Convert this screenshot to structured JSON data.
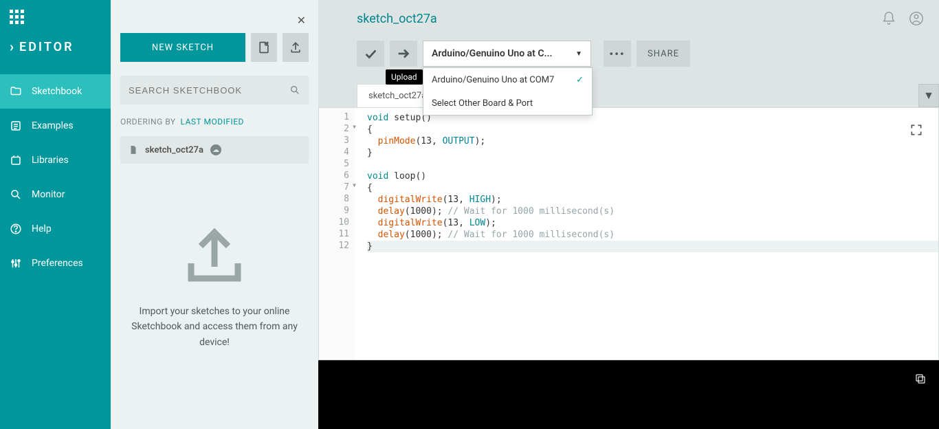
{
  "leftnav": {
    "title": "EDITOR",
    "items": [
      {
        "label": "Sketchbook"
      },
      {
        "label": "Examples"
      },
      {
        "label": "Libraries"
      },
      {
        "label": "Monitor"
      },
      {
        "label": "Help"
      },
      {
        "label": "Preferences"
      }
    ]
  },
  "sketchpanel": {
    "new_label": "NEW SKETCH",
    "search_placeholder": "SEARCH SKETCHBOOK",
    "ordering_by": "ORDERING BY",
    "ordering_val": "LAST MODIFIED",
    "items": [
      {
        "name": "sketch_oct27a"
      }
    ],
    "import_msg": "Import your sketches to your online Sketchbook and access them from any device!"
  },
  "topbar": {
    "title": "sketch_oct27a"
  },
  "toolbar": {
    "upload_tooltip": "Upload",
    "board_selected": "Arduino/Genuino Uno at C...",
    "dropdown": [
      {
        "label": "Arduino/Genuino Uno at COM7",
        "selected": true
      },
      {
        "label": "Select Other Board & Port",
        "selected": false
      }
    ],
    "more": "•••",
    "share": "SHARE"
  },
  "tabs": {
    "active": "sketch_oct27a"
  },
  "code": {
    "setup_sig": "void setup()",
    "loop_sig": "void loop()",
    "pinmode": "pinMode",
    "digitalwrite": "digitalWrite",
    "delay": "delay",
    "output": "OUTPUT",
    "high": "HIGH",
    "low": "LOW",
    "n13": "13",
    "n1000": "1000",
    "wait_comment": "// Wait for 1000 millisecond(s)"
  }
}
